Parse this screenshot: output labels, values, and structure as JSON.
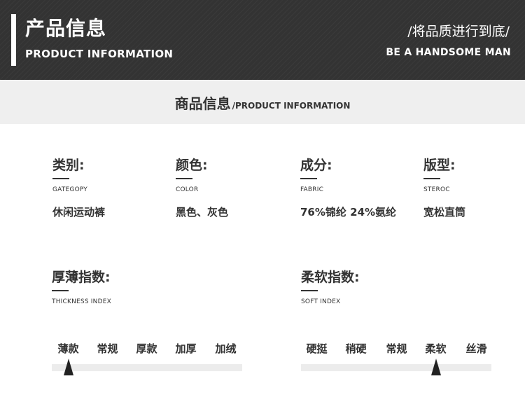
{
  "header": {
    "title": "产品信息",
    "subtitle": "PRODUCT INFORMATION",
    "slogan": "/将品质进行到底/",
    "slogan_en": "BE A HANDSOME MAN"
  },
  "section": {
    "title_cn": "商品信息",
    "title_en": "/PRODUCT INFORMATION"
  },
  "attributes": [
    {
      "label": "类别:",
      "en": "GATEGOPY",
      "value": "休闲运动裤"
    },
    {
      "label": "颜色:",
      "en": "COLOR",
      "value": "黑色、灰色"
    },
    {
      "label": "成分:",
      "en": "FABRIC",
      "value": "76%锦纶 24%氨纶"
    },
    {
      "label": "版型:",
      "en": "STEROC",
      "value": "宽松直筒"
    }
  ],
  "thickness": {
    "label": "厚薄指数:",
    "en": "THICKNESS INDEX",
    "options": [
      "薄款",
      "常规",
      "厚款",
      "加厚",
      "加绒"
    ],
    "selected_index": 0
  },
  "softness": {
    "label": "柔软指数:",
    "en": "SOFT INDEX",
    "options": [
      "硬挺",
      "稍硬",
      "常规",
      "柔软",
      "丝滑"
    ],
    "selected_index": 3
  },
  "colors": {
    "header_bg": "#333333",
    "band_bg": "#efefef",
    "track": "#ececec",
    "text": "#333333"
  }
}
